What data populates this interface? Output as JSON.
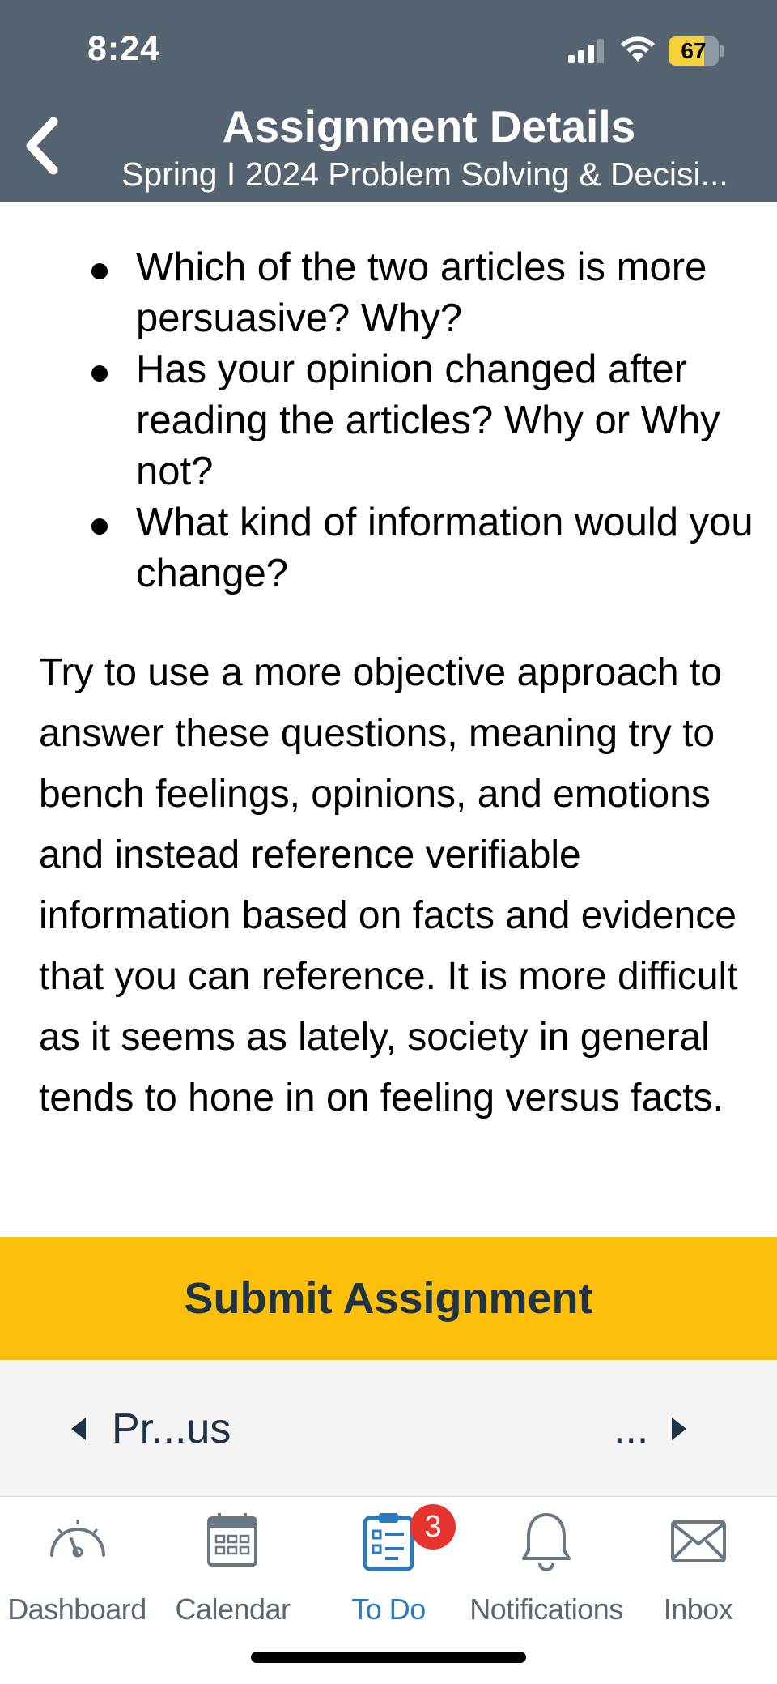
{
  "status_bar": {
    "time": "8:24",
    "battery": "67"
  },
  "header": {
    "title": "Assignment Details",
    "subtitle": "Spring I 2024 Problem Solving & Decisi..."
  },
  "content": {
    "bullets": [
      "Which of the two articles is more persuasive? Why?",
      "Has your opinion changed after reading the articles? Why or Why not?",
      "What kind of information would you change?"
    ],
    "paragraph": "Try to use a more objective approach to answer these questions, meaning try to bench feelings, opinions, and emotions and instead reference verifiable information based on facts and evidence that you can reference. It is more difficult as it seems as lately, society in general tends to hone in on feeling versus facts."
  },
  "submit_label": "Submit Assignment",
  "pager": {
    "prev_label": "Pr...us",
    "next_label": "..."
  },
  "tabs": [
    {
      "label": "Dashboard",
      "icon": "dashboard-icon"
    },
    {
      "label": "Calendar",
      "icon": "calendar-icon"
    },
    {
      "label": "To Do",
      "icon": "todo-icon",
      "active": true,
      "badge": "3"
    },
    {
      "label": "Notifications",
      "icon": "bell-icon"
    },
    {
      "label": "Inbox",
      "icon": "mail-icon"
    }
  ],
  "colors": {
    "header": "#566472",
    "submit": "#fcbf0c",
    "active_tab": "#2b7abc",
    "badge": "#e8332e"
  }
}
